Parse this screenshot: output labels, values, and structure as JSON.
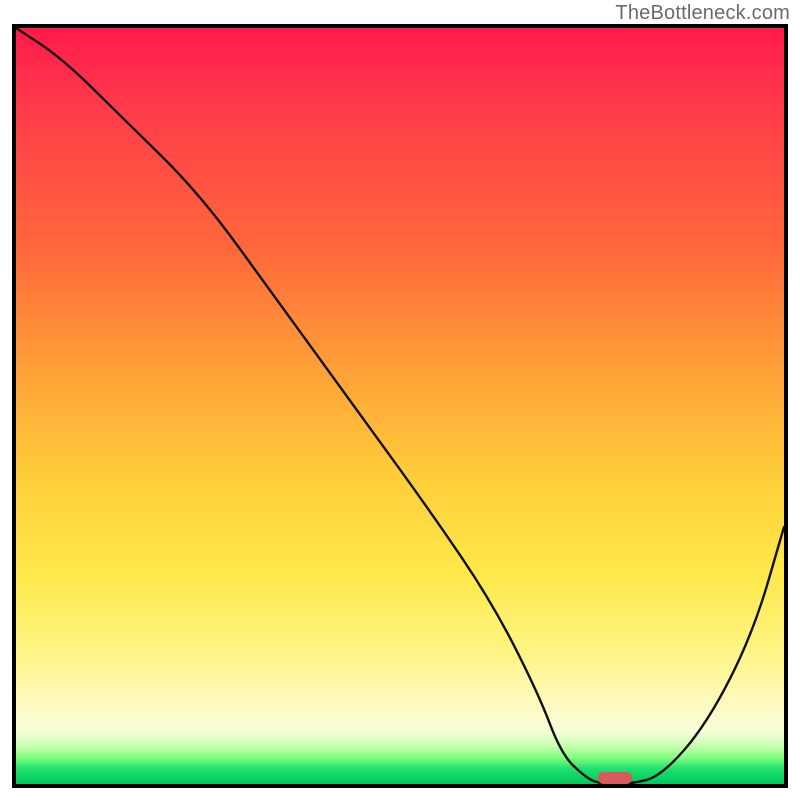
{
  "watermark": "TheBottleneck.com",
  "chart_data": {
    "type": "line",
    "title": "",
    "xlabel": "",
    "ylabel": "",
    "xlim": [
      0,
      100
    ],
    "ylim": [
      0,
      100
    ],
    "grid": false,
    "legend": false,
    "series": [
      {
        "name": "bottleneck-curve",
        "x": [
          0,
          6,
          14,
          24,
          34,
          44,
          54,
          62,
          68,
          71,
          74,
          76,
          80,
          84,
          90,
          96,
          100
        ],
        "values": [
          100,
          96,
          88,
          78,
          64,
          50,
          36,
          24,
          12,
          4,
          1,
          0,
          0,
          1,
          8,
          20,
          34
        ]
      }
    ],
    "marker": {
      "name": "optimal-marker",
      "x_center": 78,
      "y": 0.8,
      "width": 4.5,
      "color": "#d85a5a"
    },
    "background_gradient": {
      "stops": [
        {
          "pos": 0.0,
          "color": "#ff1a4a"
        },
        {
          "pos": 0.3,
          "color": "#ff6a3a"
        },
        {
          "pos": 0.6,
          "color": "#ffcf3a"
        },
        {
          "pos": 0.9,
          "color": "#fffac4"
        },
        {
          "pos": 0.97,
          "color": "#80ff80"
        },
        {
          "pos": 1.0,
          "color": "#00c85a"
        }
      ]
    }
  }
}
